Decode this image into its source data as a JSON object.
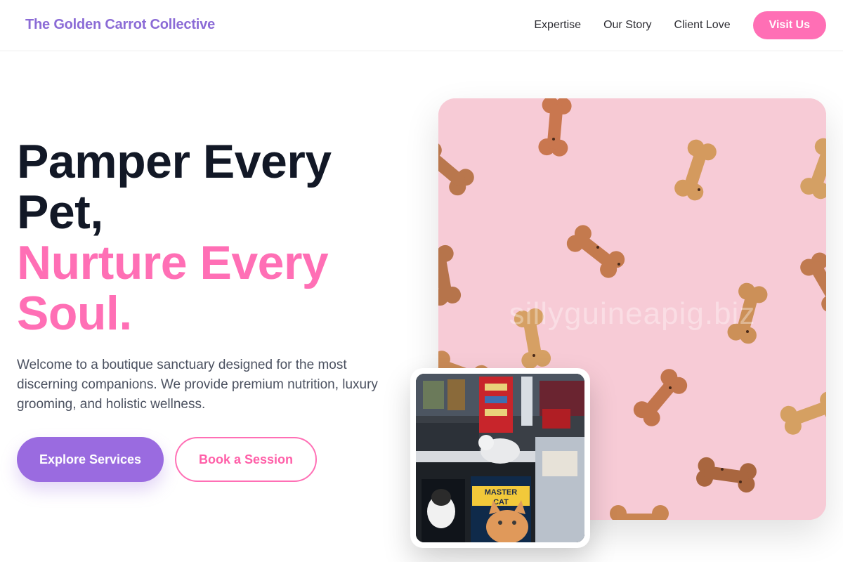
{
  "header": {
    "brand": "The Golden Carrot Collective",
    "nav": [
      "Expertise",
      "Our Story",
      "Client Love"
    ],
    "cta_label": "Visit Us"
  },
  "hero": {
    "title_line1": "Pamper Every",
    "title_line2": "Pet,",
    "title_accent_line1": "Nurture Every",
    "title_accent_line2": "Soul.",
    "description": "Welcome to a boutique sanctuary designed for the most discerning companions. We provide premium nutrition, luxury grooming, and holistic wellness.",
    "primary_button": "Explore Services",
    "secondary_button": "Book a Session"
  },
  "images": {
    "main_watermark": "sillyguineapig.biz",
    "inset_sign_line1": "MASTER",
    "inset_sign_line2": "CAT"
  },
  "colors": {
    "brand_purple": "#8b6bd6",
    "accent_pink": "#ff6fb5",
    "primary_button": "#9a6be0",
    "heading_dark": "#121826",
    "photo_background": "#f7cbd6"
  }
}
